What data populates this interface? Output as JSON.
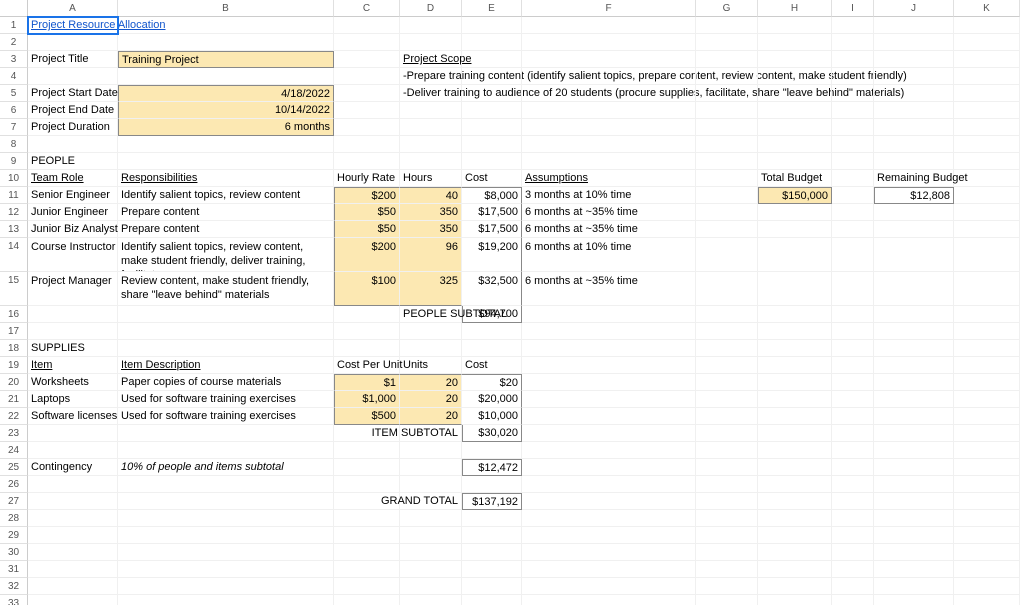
{
  "columns": [
    "A",
    "B",
    "C",
    "D",
    "E",
    "F",
    "G",
    "H",
    "I",
    "J",
    "K"
  ],
  "rowCount": 33,
  "tallRows": [
    14,
    15
  ],
  "title": "Project Resource Allocation",
  "projLabels": {
    "title": "Project Title",
    "start": "Project Start Date",
    "end": "Project End Date",
    "duration": "Project Duration"
  },
  "projValues": {
    "title": "Training Project",
    "start": "4/18/2022",
    "end": "10/14/2022",
    "duration": "6 months"
  },
  "scope": {
    "header": "Project Scope",
    "line1": "-Prepare training content (identify salient topics, prepare content, review content, make student friendly)",
    "line2": "-Deliver training to audience of 20 students (procure supplies, facilitate, share \"leave behind\" materials)"
  },
  "budget": {
    "totalLabel": "Total Budget",
    "totalValue": "$150,000",
    "remainingLabel": "Remaining Budget",
    "remainingValue": "$12,808"
  },
  "peopleSection": {
    "header": "PEOPLE",
    "cols": {
      "role": "Team Role",
      "resp": "Responsibilities",
      "rate": "Hourly Rate",
      "hours": "Hours",
      "cost": "Cost",
      "assump": "Assumptions"
    },
    "rows": [
      {
        "role": "Senior Engineer",
        "resp": "Identify salient topics, review content",
        "rate": "$200",
        "hours": "40",
        "cost": "$8,000",
        "assump": "3 months at 10% time"
      },
      {
        "role": "Junior Engineer",
        "resp": "Prepare content",
        "rate": "$50",
        "hours": "350",
        "cost": "$17,500",
        "assump": "6 months at ~35% time"
      },
      {
        "role": "Junior Biz Analyst",
        "resp": "Prepare content",
        "rate": "$50",
        "hours": "350",
        "cost": "$17,500",
        "assump": "6 months at ~35% time"
      },
      {
        "role": "Course Instructor",
        "resp": "Identify salient topics, review content, make student friendly, deliver training, facilitate",
        "rate": "$200",
        "hours": "96",
        "cost": "$19,200",
        "assump": "6 months at 10% time"
      },
      {
        "role": "Project Manager",
        "resp": "Review content, make student friendly, share \"leave behind\" materials",
        "rate": "$100",
        "hours": "325",
        "cost": "$32,500",
        "assump": "6 months at ~35% time"
      }
    ],
    "subtotalLabel": "PEOPLE SUBTOTAL",
    "subtotalValue": "$94,700"
  },
  "suppliesSection": {
    "header": "SUPPLIES",
    "cols": {
      "item": "Item",
      "desc": "Item Description",
      "cost": "Cost Per Unit",
      "units": "Units",
      "total": "Cost"
    },
    "rows": [
      {
        "item": "Worksheets",
        "desc": "Paper copies of course materials",
        "cost": "$1",
        "units": "20",
        "total": "$20"
      },
      {
        "item": "Laptops",
        "desc": "Used for software training exercises",
        "cost": "$1,000",
        "units": "20",
        "total": "$20,000"
      },
      {
        "item": "Software licenses",
        "desc": "Used for software training exercises",
        "cost": "$500",
        "units": "20",
        "total": "$10,000"
      }
    ],
    "subtotalLabel": "ITEM SUBTOTAL",
    "subtotalValue": "$30,020"
  },
  "contingency": {
    "label": "Contingency",
    "desc": "10% of people and items subtotal",
    "value": "$12,472"
  },
  "grandTotal": {
    "label": "GRAND TOTAL",
    "value": "$137,192"
  }
}
